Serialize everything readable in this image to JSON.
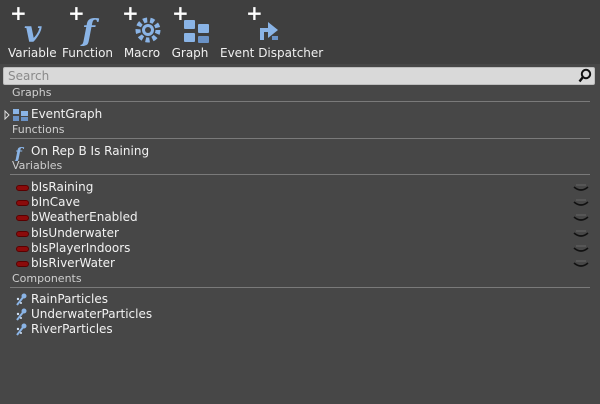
{
  "toolbar": {
    "variable_label": "Variable",
    "function_label": "Function",
    "macro_label": "Macro",
    "graph_label": "Graph",
    "dispatcher_label": "Event Dispatcher"
  },
  "search": {
    "placeholder": "Search"
  },
  "sections": {
    "graphs": "Graphs",
    "functions": "Functions",
    "variables": "Variables",
    "components": "Components"
  },
  "graphs": [
    {
      "label": "EventGraph",
      "icon": "graph-icon"
    }
  ],
  "functions": [
    {
      "label": "On Rep B Is Raining",
      "icon": "function-icon"
    }
  ],
  "variables": [
    {
      "label": "bIsRaining",
      "color": "#8b0b0b"
    },
    {
      "label": "bInCave",
      "color": "#8b0b0b"
    },
    {
      "label": "bWeatherEnabled",
      "color": "#8b0b0b"
    },
    {
      "label": "bIsUnderwater",
      "color": "#8b0b0b"
    },
    {
      "label": "bIsPlayerIndoors",
      "color": "#8b0b0b"
    },
    {
      "label": "bIsRiverWater",
      "color": "#8b0b0b"
    }
  ],
  "components": [
    {
      "label": "RainParticles",
      "icon": "particle-system-icon"
    },
    {
      "label": "UnderwaterParticles",
      "icon": "particle-system-icon"
    },
    {
      "label": "RiverParticles",
      "icon": "particle-system-icon"
    }
  ]
}
